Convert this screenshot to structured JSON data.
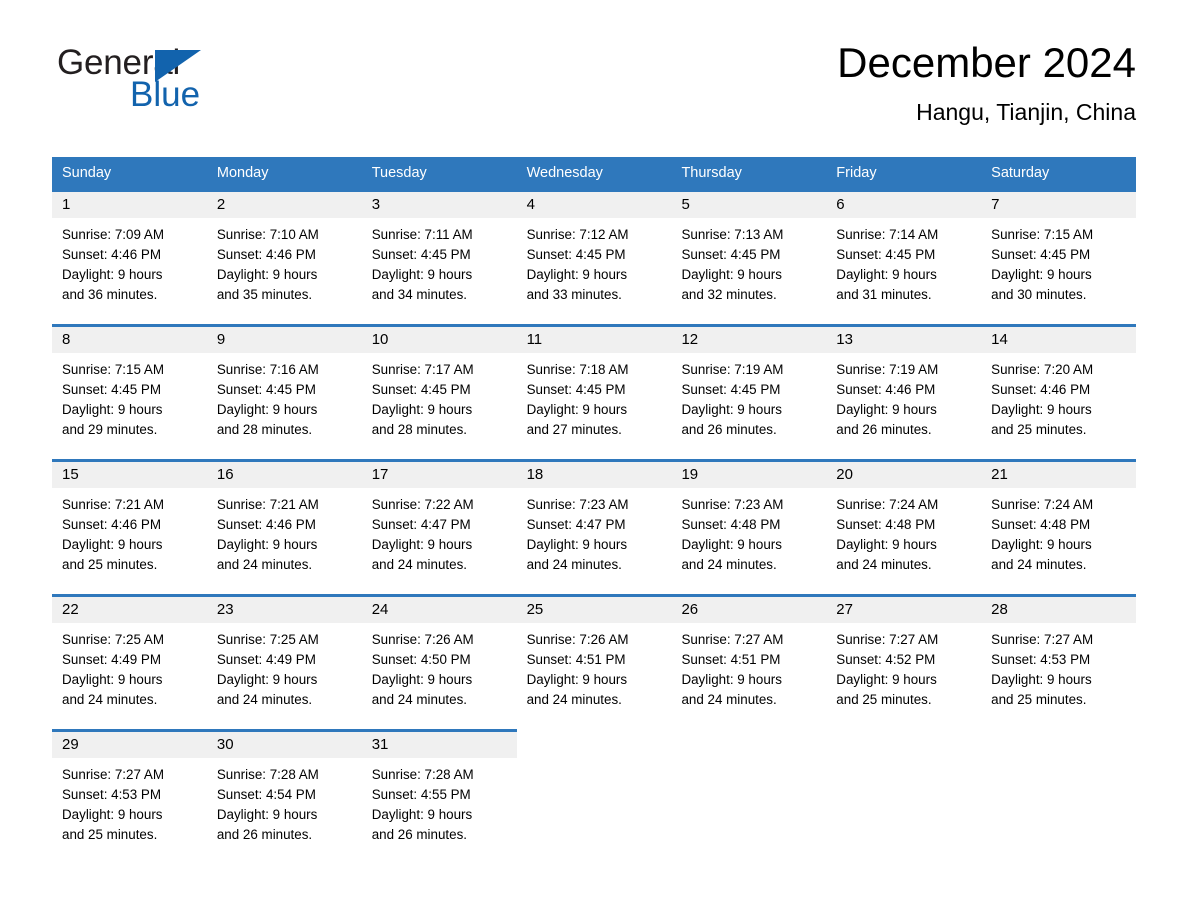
{
  "brand": {
    "name_part1": "General",
    "name_part2": "Blue",
    "logo_icon": "triangle-logo-icon",
    "accent_color": "#1263ad"
  },
  "header": {
    "month_title": "December 2024",
    "location": "Hangu, Tianjin, China"
  },
  "calendar": {
    "header_bg_color": "#2f78bc",
    "daynum_band_color": "#f0f0f0",
    "weekdays": [
      "Sunday",
      "Monday",
      "Tuesday",
      "Wednesday",
      "Thursday",
      "Friday",
      "Saturday"
    ],
    "weeks": [
      [
        {
          "day": "1",
          "sunrise": "Sunrise: 7:09 AM",
          "sunset": "Sunset: 4:46 PM",
          "daylight_line1": "Daylight: 9 hours",
          "daylight_line2": "and 36 minutes."
        },
        {
          "day": "2",
          "sunrise": "Sunrise: 7:10 AM",
          "sunset": "Sunset: 4:46 PM",
          "daylight_line1": "Daylight: 9 hours",
          "daylight_line2": "and 35 minutes."
        },
        {
          "day": "3",
          "sunrise": "Sunrise: 7:11 AM",
          "sunset": "Sunset: 4:45 PM",
          "daylight_line1": "Daylight: 9 hours",
          "daylight_line2": "and 34 minutes."
        },
        {
          "day": "4",
          "sunrise": "Sunrise: 7:12 AM",
          "sunset": "Sunset: 4:45 PM",
          "daylight_line1": "Daylight: 9 hours",
          "daylight_line2": "and 33 minutes."
        },
        {
          "day": "5",
          "sunrise": "Sunrise: 7:13 AM",
          "sunset": "Sunset: 4:45 PM",
          "daylight_line1": "Daylight: 9 hours",
          "daylight_line2": "and 32 minutes."
        },
        {
          "day": "6",
          "sunrise": "Sunrise: 7:14 AM",
          "sunset": "Sunset: 4:45 PM",
          "daylight_line1": "Daylight: 9 hours",
          "daylight_line2": "and 31 minutes."
        },
        {
          "day": "7",
          "sunrise": "Sunrise: 7:15 AM",
          "sunset": "Sunset: 4:45 PM",
          "daylight_line1": "Daylight: 9 hours",
          "daylight_line2": "and 30 minutes."
        }
      ],
      [
        {
          "day": "8",
          "sunrise": "Sunrise: 7:15 AM",
          "sunset": "Sunset: 4:45 PM",
          "daylight_line1": "Daylight: 9 hours",
          "daylight_line2": "and 29 minutes."
        },
        {
          "day": "9",
          "sunrise": "Sunrise: 7:16 AM",
          "sunset": "Sunset: 4:45 PM",
          "daylight_line1": "Daylight: 9 hours",
          "daylight_line2": "and 28 minutes."
        },
        {
          "day": "10",
          "sunrise": "Sunrise: 7:17 AM",
          "sunset": "Sunset: 4:45 PM",
          "daylight_line1": "Daylight: 9 hours",
          "daylight_line2": "and 28 minutes."
        },
        {
          "day": "11",
          "sunrise": "Sunrise: 7:18 AM",
          "sunset": "Sunset: 4:45 PM",
          "daylight_line1": "Daylight: 9 hours",
          "daylight_line2": "and 27 minutes."
        },
        {
          "day": "12",
          "sunrise": "Sunrise: 7:19 AM",
          "sunset": "Sunset: 4:45 PM",
          "daylight_line1": "Daylight: 9 hours",
          "daylight_line2": "and 26 minutes."
        },
        {
          "day": "13",
          "sunrise": "Sunrise: 7:19 AM",
          "sunset": "Sunset: 4:46 PM",
          "daylight_line1": "Daylight: 9 hours",
          "daylight_line2": "and 26 minutes."
        },
        {
          "day": "14",
          "sunrise": "Sunrise: 7:20 AM",
          "sunset": "Sunset: 4:46 PM",
          "daylight_line1": "Daylight: 9 hours",
          "daylight_line2": "and 25 minutes."
        }
      ],
      [
        {
          "day": "15",
          "sunrise": "Sunrise: 7:21 AM",
          "sunset": "Sunset: 4:46 PM",
          "daylight_line1": "Daylight: 9 hours",
          "daylight_line2": "and 25 minutes."
        },
        {
          "day": "16",
          "sunrise": "Sunrise: 7:21 AM",
          "sunset": "Sunset: 4:46 PM",
          "daylight_line1": "Daylight: 9 hours",
          "daylight_line2": "and 24 minutes."
        },
        {
          "day": "17",
          "sunrise": "Sunrise: 7:22 AM",
          "sunset": "Sunset: 4:47 PM",
          "daylight_line1": "Daylight: 9 hours",
          "daylight_line2": "and 24 minutes."
        },
        {
          "day": "18",
          "sunrise": "Sunrise: 7:23 AM",
          "sunset": "Sunset: 4:47 PM",
          "daylight_line1": "Daylight: 9 hours",
          "daylight_line2": "and 24 minutes."
        },
        {
          "day": "19",
          "sunrise": "Sunrise: 7:23 AM",
          "sunset": "Sunset: 4:48 PM",
          "daylight_line1": "Daylight: 9 hours",
          "daylight_line2": "and 24 minutes."
        },
        {
          "day": "20",
          "sunrise": "Sunrise: 7:24 AM",
          "sunset": "Sunset: 4:48 PM",
          "daylight_line1": "Daylight: 9 hours",
          "daylight_line2": "and 24 minutes."
        },
        {
          "day": "21",
          "sunrise": "Sunrise: 7:24 AM",
          "sunset": "Sunset: 4:48 PM",
          "daylight_line1": "Daylight: 9 hours",
          "daylight_line2": "and 24 minutes."
        }
      ],
      [
        {
          "day": "22",
          "sunrise": "Sunrise: 7:25 AM",
          "sunset": "Sunset: 4:49 PM",
          "daylight_line1": "Daylight: 9 hours",
          "daylight_line2": "and 24 minutes."
        },
        {
          "day": "23",
          "sunrise": "Sunrise: 7:25 AM",
          "sunset": "Sunset: 4:49 PM",
          "daylight_line1": "Daylight: 9 hours",
          "daylight_line2": "and 24 minutes."
        },
        {
          "day": "24",
          "sunrise": "Sunrise: 7:26 AM",
          "sunset": "Sunset: 4:50 PM",
          "daylight_line1": "Daylight: 9 hours",
          "daylight_line2": "and 24 minutes."
        },
        {
          "day": "25",
          "sunrise": "Sunrise: 7:26 AM",
          "sunset": "Sunset: 4:51 PM",
          "daylight_line1": "Daylight: 9 hours",
          "daylight_line2": "and 24 minutes."
        },
        {
          "day": "26",
          "sunrise": "Sunrise: 7:27 AM",
          "sunset": "Sunset: 4:51 PM",
          "daylight_line1": "Daylight: 9 hours",
          "daylight_line2": "and 24 minutes."
        },
        {
          "day": "27",
          "sunrise": "Sunrise: 7:27 AM",
          "sunset": "Sunset: 4:52 PM",
          "daylight_line1": "Daylight: 9 hours",
          "daylight_line2": "and 25 minutes."
        },
        {
          "day": "28",
          "sunrise": "Sunrise: 7:27 AM",
          "sunset": "Sunset: 4:53 PM",
          "daylight_line1": "Daylight: 9 hours",
          "daylight_line2": "and 25 minutes."
        }
      ],
      [
        {
          "day": "29",
          "sunrise": "Sunrise: 7:27 AM",
          "sunset": "Sunset: 4:53 PM",
          "daylight_line1": "Daylight: 9 hours",
          "daylight_line2": "and 25 minutes."
        },
        {
          "day": "30",
          "sunrise": "Sunrise: 7:28 AM",
          "sunset": "Sunset: 4:54 PM",
          "daylight_line1": "Daylight: 9 hours",
          "daylight_line2": "and 26 minutes."
        },
        {
          "day": "31",
          "sunrise": "Sunrise: 7:28 AM",
          "sunset": "Sunset: 4:55 PM",
          "daylight_line1": "Daylight: 9 hours",
          "daylight_line2": "and 26 minutes."
        },
        {
          "day": "",
          "sunrise": "",
          "sunset": "",
          "daylight_line1": "",
          "daylight_line2": ""
        },
        {
          "day": "",
          "sunrise": "",
          "sunset": "",
          "daylight_line1": "",
          "daylight_line2": ""
        },
        {
          "day": "",
          "sunrise": "",
          "sunset": "",
          "daylight_line1": "",
          "daylight_line2": ""
        },
        {
          "day": "",
          "sunrise": "",
          "sunset": "",
          "daylight_line1": "",
          "daylight_line2": ""
        }
      ]
    ]
  }
}
